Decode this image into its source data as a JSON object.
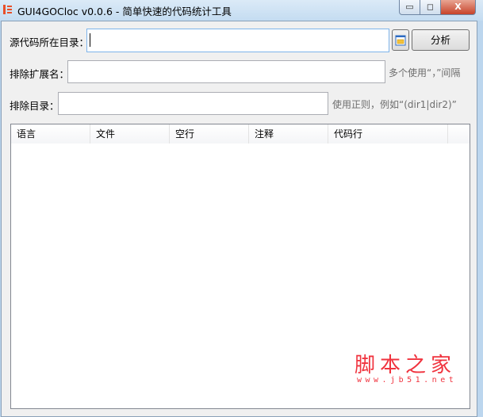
{
  "window": {
    "title": "GUI4GOCloc v0.0.6 - 简单快速的代码统计工具",
    "minimize": "▭",
    "maximize": "◻",
    "close": "X"
  },
  "form": {
    "source_label": "源代码所在目录：",
    "source_value": "",
    "analyze_label": "分析",
    "ext_label": "排除扩展名：",
    "ext_value": "",
    "ext_hint": "多个使用“，”间隔",
    "dir_label": "排除目录：",
    "dir_value": "",
    "dir_hint": "使用正则，例如“(dir1|dir2)”"
  },
  "table": {
    "columns": [
      "语言",
      "文件",
      "空行",
      "注释",
      "代码行"
    ],
    "rows": []
  },
  "watermark": {
    "title": "脚本之家",
    "url": "www.jb51.net"
  }
}
